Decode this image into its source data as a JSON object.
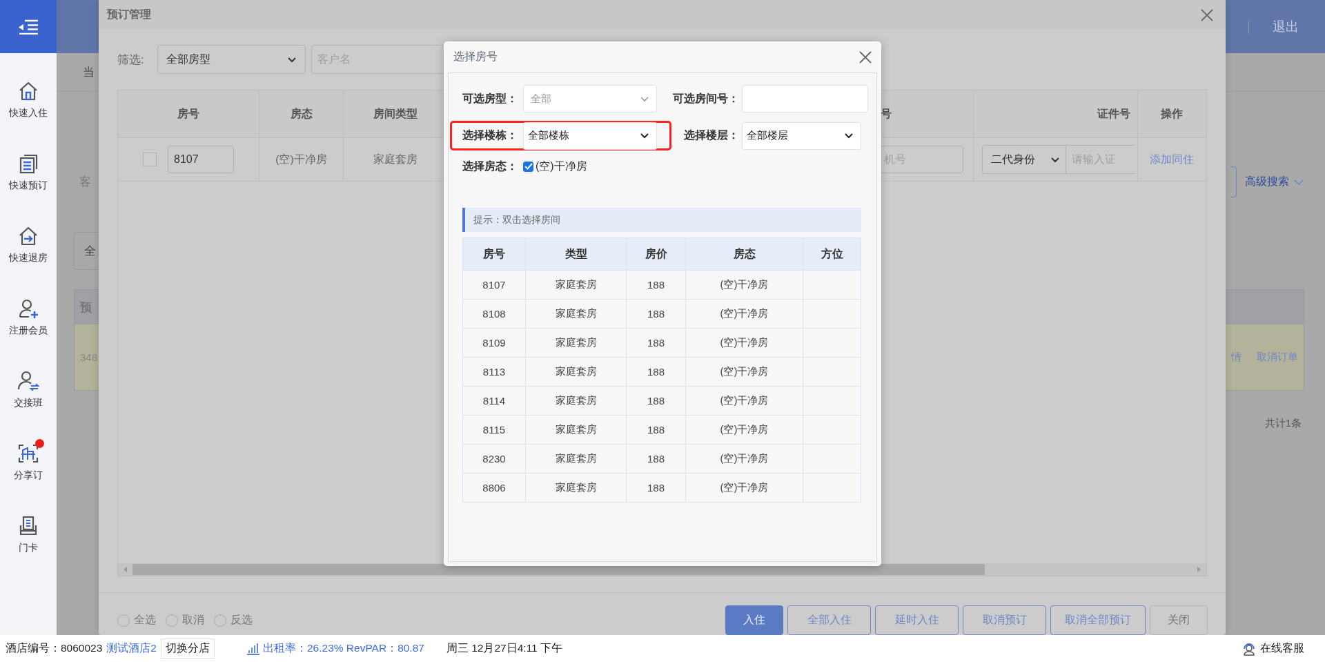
{
  "sidebar": {
    "items": [
      {
        "kind": "checkin",
        "label": "快速入住",
        "notification": false
      },
      {
        "kind": "booking",
        "label": "快速预订",
        "notification": false
      },
      {
        "kind": "checkout",
        "label": "快速退房",
        "notification": false
      },
      {
        "kind": "member",
        "label": "注册会员",
        "notification": false
      },
      {
        "kind": "shift",
        "label": "交接班",
        "notification": false
      },
      {
        "kind": "share",
        "label": "分享订",
        "notification": true
      },
      {
        "kind": "card",
        "label": "门卡",
        "notification": false
      }
    ]
  },
  "header": {
    "logout": "退出"
  },
  "background_page": {
    "tab": "当",
    "query_label": "客",
    "advanced_search": "高级搜索",
    "search_field": "全",
    "table_header": "预",
    "row_id": "348",
    "row_links": [
      "情",
      "取消订单"
    ],
    "total": "共计1条"
  },
  "booking_dialog": {
    "title": "预订管理",
    "filter_label": "筛选:",
    "room_type": "全部房型",
    "customer_placeholder": "客户名",
    "columns": [
      "房号",
      "房态",
      "房间类型",
      "号",
      "证件号",
      "操作"
    ],
    "rows": [
      {
        "checked": false,
        "room": "8107",
        "status": "(空)干净房",
        "type": "家庭套房",
        "phone_placeholder": "机号",
        "id_type": "二代身份",
        "id_placeholder": "请输入证",
        "action": "添加同住"
      }
    ],
    "selection": [
      {
        "label": "全选",
        "selected": false
      },
      {
        "label": "取消",
        "selected": false
      },
      {
        "label": "反选",
        "selected": false
      }
    ],
    "buttons": [
      {
        "label": "入住",
        "kind": "primary"
      },
      {
        "label": "全部入住",
        "kind": "outline"
      },
      {
        "label": "延时入住",
        "kind": "outline"
      },
      {
        "label": "取消预订",
        "kind": "outline"
      },
      {
        "label": "取消全部预订",
        "kind": "outline"
      },
      {
        "label": "关闭",
        "kind": "plain"
      }
    ]
  },
  "room_picker": {
    "title": "选择房号",
    "room_type_label": "可选房型：",
    "room_type": {
      "value": "全部",
      "disabled": true
    },
    "room_number_label": "可选房间号：",
    "building_label": "选择楼栋：",
    "building": "全部楼栋",
    "floor_label": "选择楼层：",
    "floor": "全部楼层",
    "status_label": "选择房态：",
    "status_option": {
      "label": "(空)干净房",
      "checked": true
    },
    "hint": "提示：双击选择房间",
    "columns": [
      "房号",
      "类型",
      "房价",
      "房态",
      "方位"
    ],
    "rows": [
      {
        "room": "8107",
        "type": "家庭套房",
        "price": "188",
        "status": "(空)干净房"
      },
      {
        "room": "8108",
        "type": "家庭套房",
        "price": "188",
        "status": "(空)干净房"
      },
      {
        "room": "8109",
        "type": "家庭套房",
        "price": "188",
        "status": "(空)干净房"
      },
      {
        "room": "8113",
        "type": "家庭套房",
        "price": "188",
        "status": "(空)干净房"
      },
      {
        "room": "8114",
        "type": "家庭套房",
        "price": "188",
        "status": "(空)干净房"
      },
      {
        "room": "8115",
        "type": "家庭套房",
        "price": "188",
        "status": "(空)干净房"
      },
      {
        "room": "8230",
        "type": "家庭套房",
        "price": "188",
        "status": "(空)干净房"
      },
      {
        "room": "8806",
        "type": "家庭套房",
        "price": "188",
        "status": "(空)干净房"
      }
    ]
  },
  "status_bar": {
    "hotel_id": "酒店编号：8060023",
    "hotel_name": "测试酒店2",
    "switch_button": "切换分店",
    "occupancy": "出租率：26.23% RevPAR：80.87",
    "datetime": "周三 12月27日4:11 下午",
    "support": "在线客服"
  }
}
